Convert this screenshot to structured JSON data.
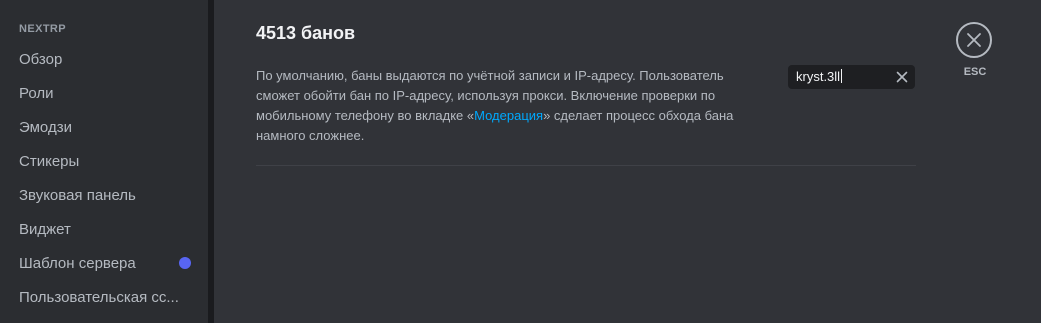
{
  "sidebar": {
    "header": "NEXTRP",
    "items": [
      {
        "label": "Обзор"
      },
      {
        "label": "Роли"
      },
      {
        "label": "Эмодзи"
      },
      {
        "label": "Стикеры"
      },
      {
        "label": "Звуковая панель"
      },
      {
        "label": "Виджет"
      },
      {
        "label": "Шаблон сервера"
      },
      {
        "label": "Пользовательская сс..."
      }
    ],
    "notification_dot_color": "#5865f2"
  },
  "main": {
    "title": "4513 банов",
    "description_before": "По умолчанию, баны выдаются по учётной записи и IP-адресу. Пользователь сможет обойти бан по IP-адресу, используя прокси. Включение проверки по мобильному телефону во вкладке «",
    "description_link": "Модерация",
    "description_after": "» сделает процесс обхода бана намного сложнее.",
    "link_color": "#00a8fc"
  },
  "search": {
    "value": "kryst.3ll",
    "clear_icon": "close-icon"
  },
  "close": {
    "icon": "close-circle-icon",
    "label": "ESC"
  }
}
